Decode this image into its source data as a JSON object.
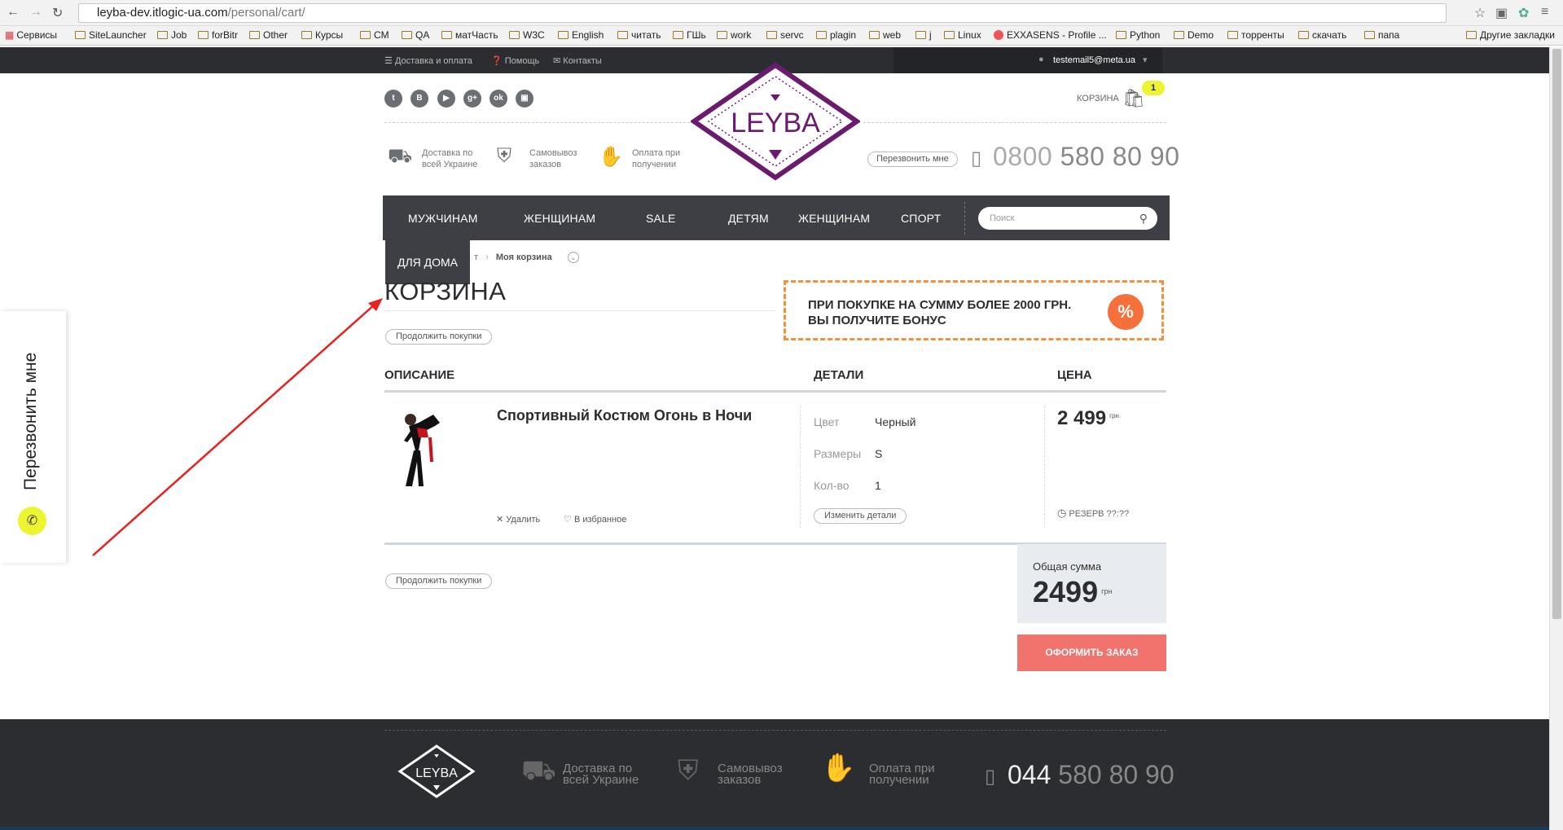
{
  "browser": {
    "url_host": "leyba-dev.itlogic-ua.com",
    "url_path": "/personal/cart/",
    "bookmarks": [
      "Сервисы",
      "SiteLauncher",
      "Job",
      "forBitr",
      "Other",
      "Курсы",
      "CM",
      "QA",
      "матЧасть",
      "W3C",
      "English",
      "читать",
      "ГШь",
      "work",
      "servc",
      "plagin",
      "web",
      "j",
      "Linux",
      "EXXASENS - Profile ...",
      "Python",
      "Demo",
      "торренты",
      "скачать",
      "папа"
    ],
    "bookmarks_other": "Другие закладки"
  },
  "topbar": {
    "delivery": "Доставка и оплата",
    "help": "Помощь",
    "contacts": "Контакты",
    "user_email": "testemail5@meta.ua"
  },
  "header": {
    "logo_text": "LEYBA",
    "cart_label": "КОРЗИНА",
    "cart_count": "1",
    "features": [
      {
        "line1": "Доставка по",
        "line2": "всей Украине"
      },
      {
        "line1": "Самовывоз",
        "line2": "заказов"
      },
      {
        "line1": "Оплата при",
        "line2": "получении"
      }
    ],
    "callback_label": "Перезвонить мне",
    "phone_prefix": "0800",
    "phone_number": "580 80 90",
    "social": [
      "t",
      "B",
      "You",
      "g+",
      "ok",
      "ig"
    ]
  },
  "nav": {
    "items": [
      "МУЖЧИНАМ",
      "ЖЕНЩИНАМ",
      "SALE",
      "ДЕТЯМ",
      "ЖЕНЩИНАМ",
      "СПОРТ"
    ],
    "dropdown_item": "ДЛЯ ДОМА",
    "search_placeholder": "Поиск"
  },
  "breadcrumb": {
    "prev": "т",
    "current": "Моя корзина"
  },
  "page": {
    "title": "КОРЗИНА",
    "continue_top": "Продолжить покупки",
    "continue_bottom": "Продолжить покупки",
    "bonus_line1": "ПРИ ПОКУПКЕ НА СУММУ БОЛЕЕ 2000 ГРН.",
    "bonus_line2": "ВЫ ПОЛУЧИТЕ БОНУС",
    "bonus_icon": "%"
  },
  "table": {
    "headers": {
      "description": "ОПИСАНИЕ",
      "details": "ДЕТАЛИ",
      "price": "ЦЕНА"
    },
    "item": {
      "name": "Спортивный Костюм Огонь в Ночи",
      "remove": "Удалить",
      "favorite": "В избранное",
      "color_label": "Цвет",
      "color_value": "Черный",
      "size_label": "Размеры",
      "size_value": "S",
      "qty_label": "Кол-во",
      "qty_value": "1",
      "edit_label": "Изменить детали",
      "price": "2 499",
      "price_unit": "грн.",
      "reserve": "РЕЗЕРВ ??:??"
    }
  },
  "totals": {
    "label": "Общая сумма",
    "value": "2499",
    "unit": "грн",
    "checkout": "ОФОРМИТЬ ЗАКАЗ"
  },
  "side_callback": "Перезвонить мне",
  "footer": {
    "logo_text": "LEYBA",
    "features": [
      {
        "line1": "Доставка по",
        "line2": "всей Украине"
      },
      {
        "line1": "Самовывоз",
        "line2": "заказов"
      },
      {
        "line1": "Оплата при",
        "line2": "получении"
      }
    ],
    "phone_prefix": "044",
    "phone_number": "580 80 90"
  },
  "colors": {
    "brand_purple": "#6a1b6e",
    "dark": "#2b2d31",
    "nav": "#3d3f44",
    "accent_yellow": "#ecf530",
    "bonus_orange": "#f5903a",
    "checkout_red": "#f2726d",
    "annotation_arrow": "#e8201e"
  }
}
